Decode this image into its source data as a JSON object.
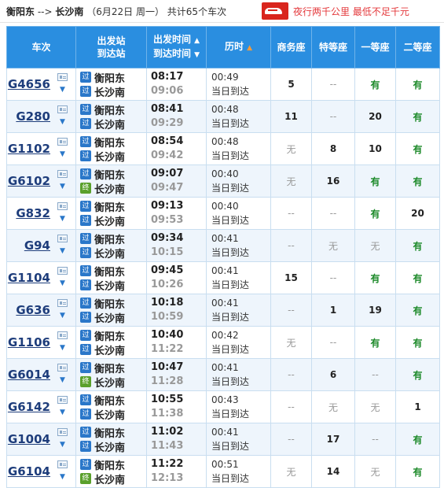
{
  "header": {
    "from": "衡阳东",
    "arrow": "-->",
    "to": "长沙南",
    "date_text": "（6月22日  周一）",
    "count_text": "共计65个车次"
  },
  "ad": {
    "text": "夜行两千公里 最低不足千元"
  },
  "table": {
    "headers": {
      "train": "车次",
      "station_1": "出发站",
      "station_2": "到达站",
      "time_1": "出发时间",
      "time_2": "到达时间",
      "duration": "历时",
      "business": "商务座",
      "special": "特等座",
      "first": "一等座",
      "second": "二等座"
    },
    "rows": [
      {
        "train": "G4656",
        "from": "衡阳东",
        "to": "长沙南",
        "from_badge": "过",
        "to_badge": "过",
        "dep": "08:17",
        "arr": "09:06",
        "dur": "00:49",
        "day": "当日到达",
        "business": "5",
        "special": "--",
        "first": "有",
        "second": "有"
      },
      {
        "train": "G280",
        "from": "衡阳东",
        "to": "长沙南",
        "from_badge": "过",
        "to_badge": "过",
        "dep": "08:41",
        "arr": "09:29",
        "dur": "00:48",
        "day": "当日到达",
        "business": "11",
        "special": "--",
        "first": "20",
        "second": "有"
      },
      {
        "train": "G1102",
        "from": "衡阳东",
        "to": "长沙南",
        "from_badge": "过",
        "to_badge": "过",
        "dep": "08:54",
        "arr": "09:42",
        "dur": "00:48",
        "day": "当日到达",
        "business": "无",
        "special": "8",
        "first": "10",
        "second": "有"
      },
      {
        "train": "G6102",
        "from": "衡阳东",
        "to": "长沙南",
        "from_badge": "过",
        "to_badge": "终",
        "dep": "09:07",
        "arr": "09:47",
        "dur": "00:40",
        "day": "当日到达",
        "business": "无",
        "special": "16",
        "first": "有",
        "second": "有"
      },
      {
        "train": "G832",
        "from": "衡阳东",
        "to": "长沙南",
        "from_badge": "过",
        "to_badge": "过",
        "dep": "09:13",
        "arr": "09:53",
        "dur": "00:40",
        "day": "当日到达",
        "business": "--",
        "special": "--",
        "first": "有",
        "second": "20"
      },
      {
        "train": "G94",
        "from": "衡阳东",
        "to": "长沙南",
        "from_badge": "过",
        "to_badge": "过",
        "dep": "09:34",
        "arr": "10:15",
        "dur": "00:41",
        "day": "当日到达",
        "business": "--",
        "special": "无",
        "first": "无",
        "second": "有"
      },
      {
        "train": "G1104",
        "from": "衡阳东",
        "to": "长沙南",
        "from_badge": "过",
        "to_badge": "过",
        "dep": "09:45",
        "arr": "10:26",
        "dur": "00:41",
        "day": "当日到达",
        "business": "15",
        "special": "--",
        "first": "有",
        "second": "有"
      },
      {
        "train": "G636",
        "from": "衡阳东",
        "to": "长沙南",
        "from_badge": "过",
        "to_badge": "过",
        "dep": "10:18",
        "arr": "10:59",
        "dur": "00:41",
        "day": "当日到达",
        "business": "--",
        "special": "1",
        "first": "19",
        "second": "有"
      },
      {
        "train": "G1106",
        "from": "衡阳东",
        "to": "长沙南",
        "from_badge": "过",
        "to_badge": "过",
        "dep": "10:40",
        "arr": "11:22",
        "dur": "00:42",
        "day": "当日到达",
        "business": "无",
        "special": "--",
        "first": "有",
        "second": "有"
      },
      {
        "train": "G6014",
        "from": "衡阳东",
        "to": "长沙南",
        "from_badge": "过",
        "to_badge": "终",
        "dep": "10:47",
        "arr": "11:28",
        "dur": "00:41",
        "day": "当日到达",
        "business": "--",
        "special": "6",
        "first": "--",
        "second": "有"
      },
      {
        "train": "G6142",
        "from": "衡阳东",
        "to": "长沙南",
        "from_badge": "过",
        "to_badge": "过",
        "dep": "10:55",
        "arr": "11:38",
        "dur": "00:43",
        "day": "当日到达",
        "business": "--",
        "special": "无",
        "first": "无",
        "second": "1"
      },
      {
        "train": "G1004",
        "from": "衡阳东",
        "to": "长沙南",
        "from_badge": "过",
        "to_badge": "过",
        "dep": "11:02",
        "arr": "11:43",
        "dur": "00:41",
        "day": "当日到达",
        "business": "--",
        "special": "17",
        "first": "--",
        "second": "有"
      },
      {
        "train": "G6104",
        "from": "衡阳东",
        "to": "长沙南",
        "from_badge": "过",
        "to_badge": "终",
        "dep": "11:22",
        "arr": "12:13",
        "dur": "00:51",
        "day": "当日到达",
        "business": "无",
        "special": "14",
        "first": "无",
        "second": "有"
      }
    ]
  },
  "colors": {
    "header_bg": "#2a8ee0",
    "available": "#1d8a2a",
    "train_link": "#1e3d7b",
    "ad_red": "#e4393c"
  }
}
